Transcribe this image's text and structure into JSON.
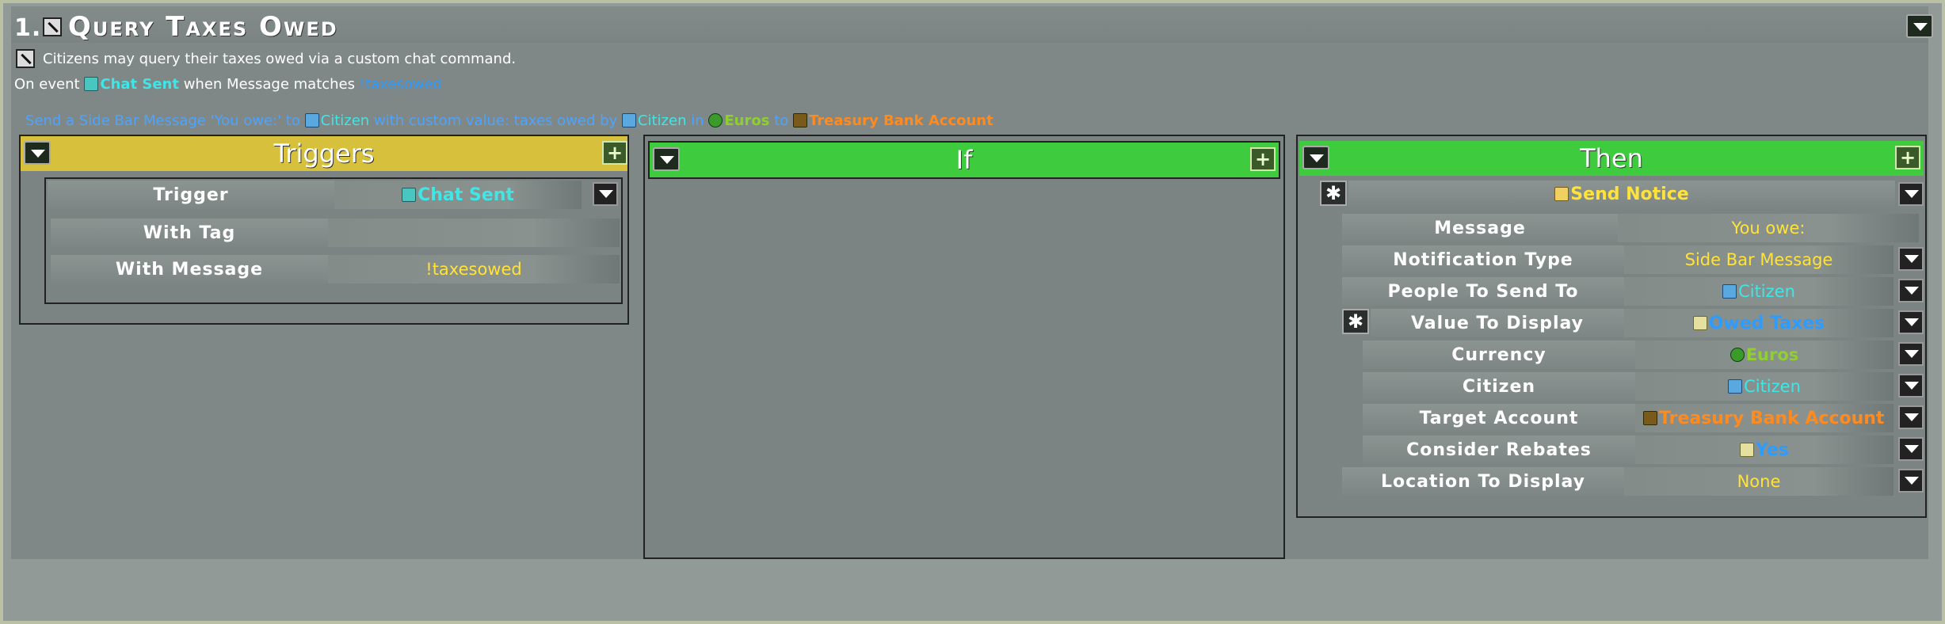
{
  "rule": {
    "number": "1.",
    "title": "Query Taxes Owed",
    "description": "Citizens may query their taxes owed via a custom chat command.",
    "event_prefix": "On event",
    "event_name": "Chat Sent",
    "event_mid": "when Message matches",
    "event_match": "!taxesowed",
    "summary": {
      "p1": "Send a Side Bar Message 'You owe:' to",
      "citizen": "Citizen",
      "p2": "with custom value: taxes owed by",
      "citizen2": "Citizen",
      "p3": "in",
      "currency": "Euros",
      "p4": "to",
      "account": "Treasury Bank Account"
    }
  },
  "triggers": {
    "header": "Triggers",
    "add_label": "+",
    "rows": [
      {
        "label": "Trigger",
        "value": "Chat Sent"
      },
      {
        "label": "With Tag",
        "value": ""
      },
      {
        "label": "With Message",
        "value": "!taxesowed"
      }
    ]
  },
  "if_col": {
    "header": "If",
    "add_label": "+"
  },
  "then_col": {
    "header": "Then",
    "add_label": "+",
    "action": "Send Notice",
    "gear": "✱",
    "rows": [
      {
        "label": "Message",
        "value": "You owe:"
      },
      {
        "label": "Notification Type",
        "value": "Side Bar Message"
      },
      {
        "label": "People To Send To",
        "value": "Citizen"
      },
      {
        "label": "Value To Display",
        "value": "Owed Taxes"
      },
      {
        "label": "Currency",
        "value": "Euros"
      },
      {
        "label": "Citizen",
        "value": "Citizen"
      },
      {
        "label": "Target Account",
        "value": "Treasury Bank Account"
      },
      {
        "label": "Consider Rebates",
        "value": "Yes"
      },
      {
        "label": "Location To Display",
        "value": "None"
      }
    ]
  },
  "colors": {
    "triggers_header": "#d6c03c",
    "if_then_header": "#3ecb3e"
  }
}
